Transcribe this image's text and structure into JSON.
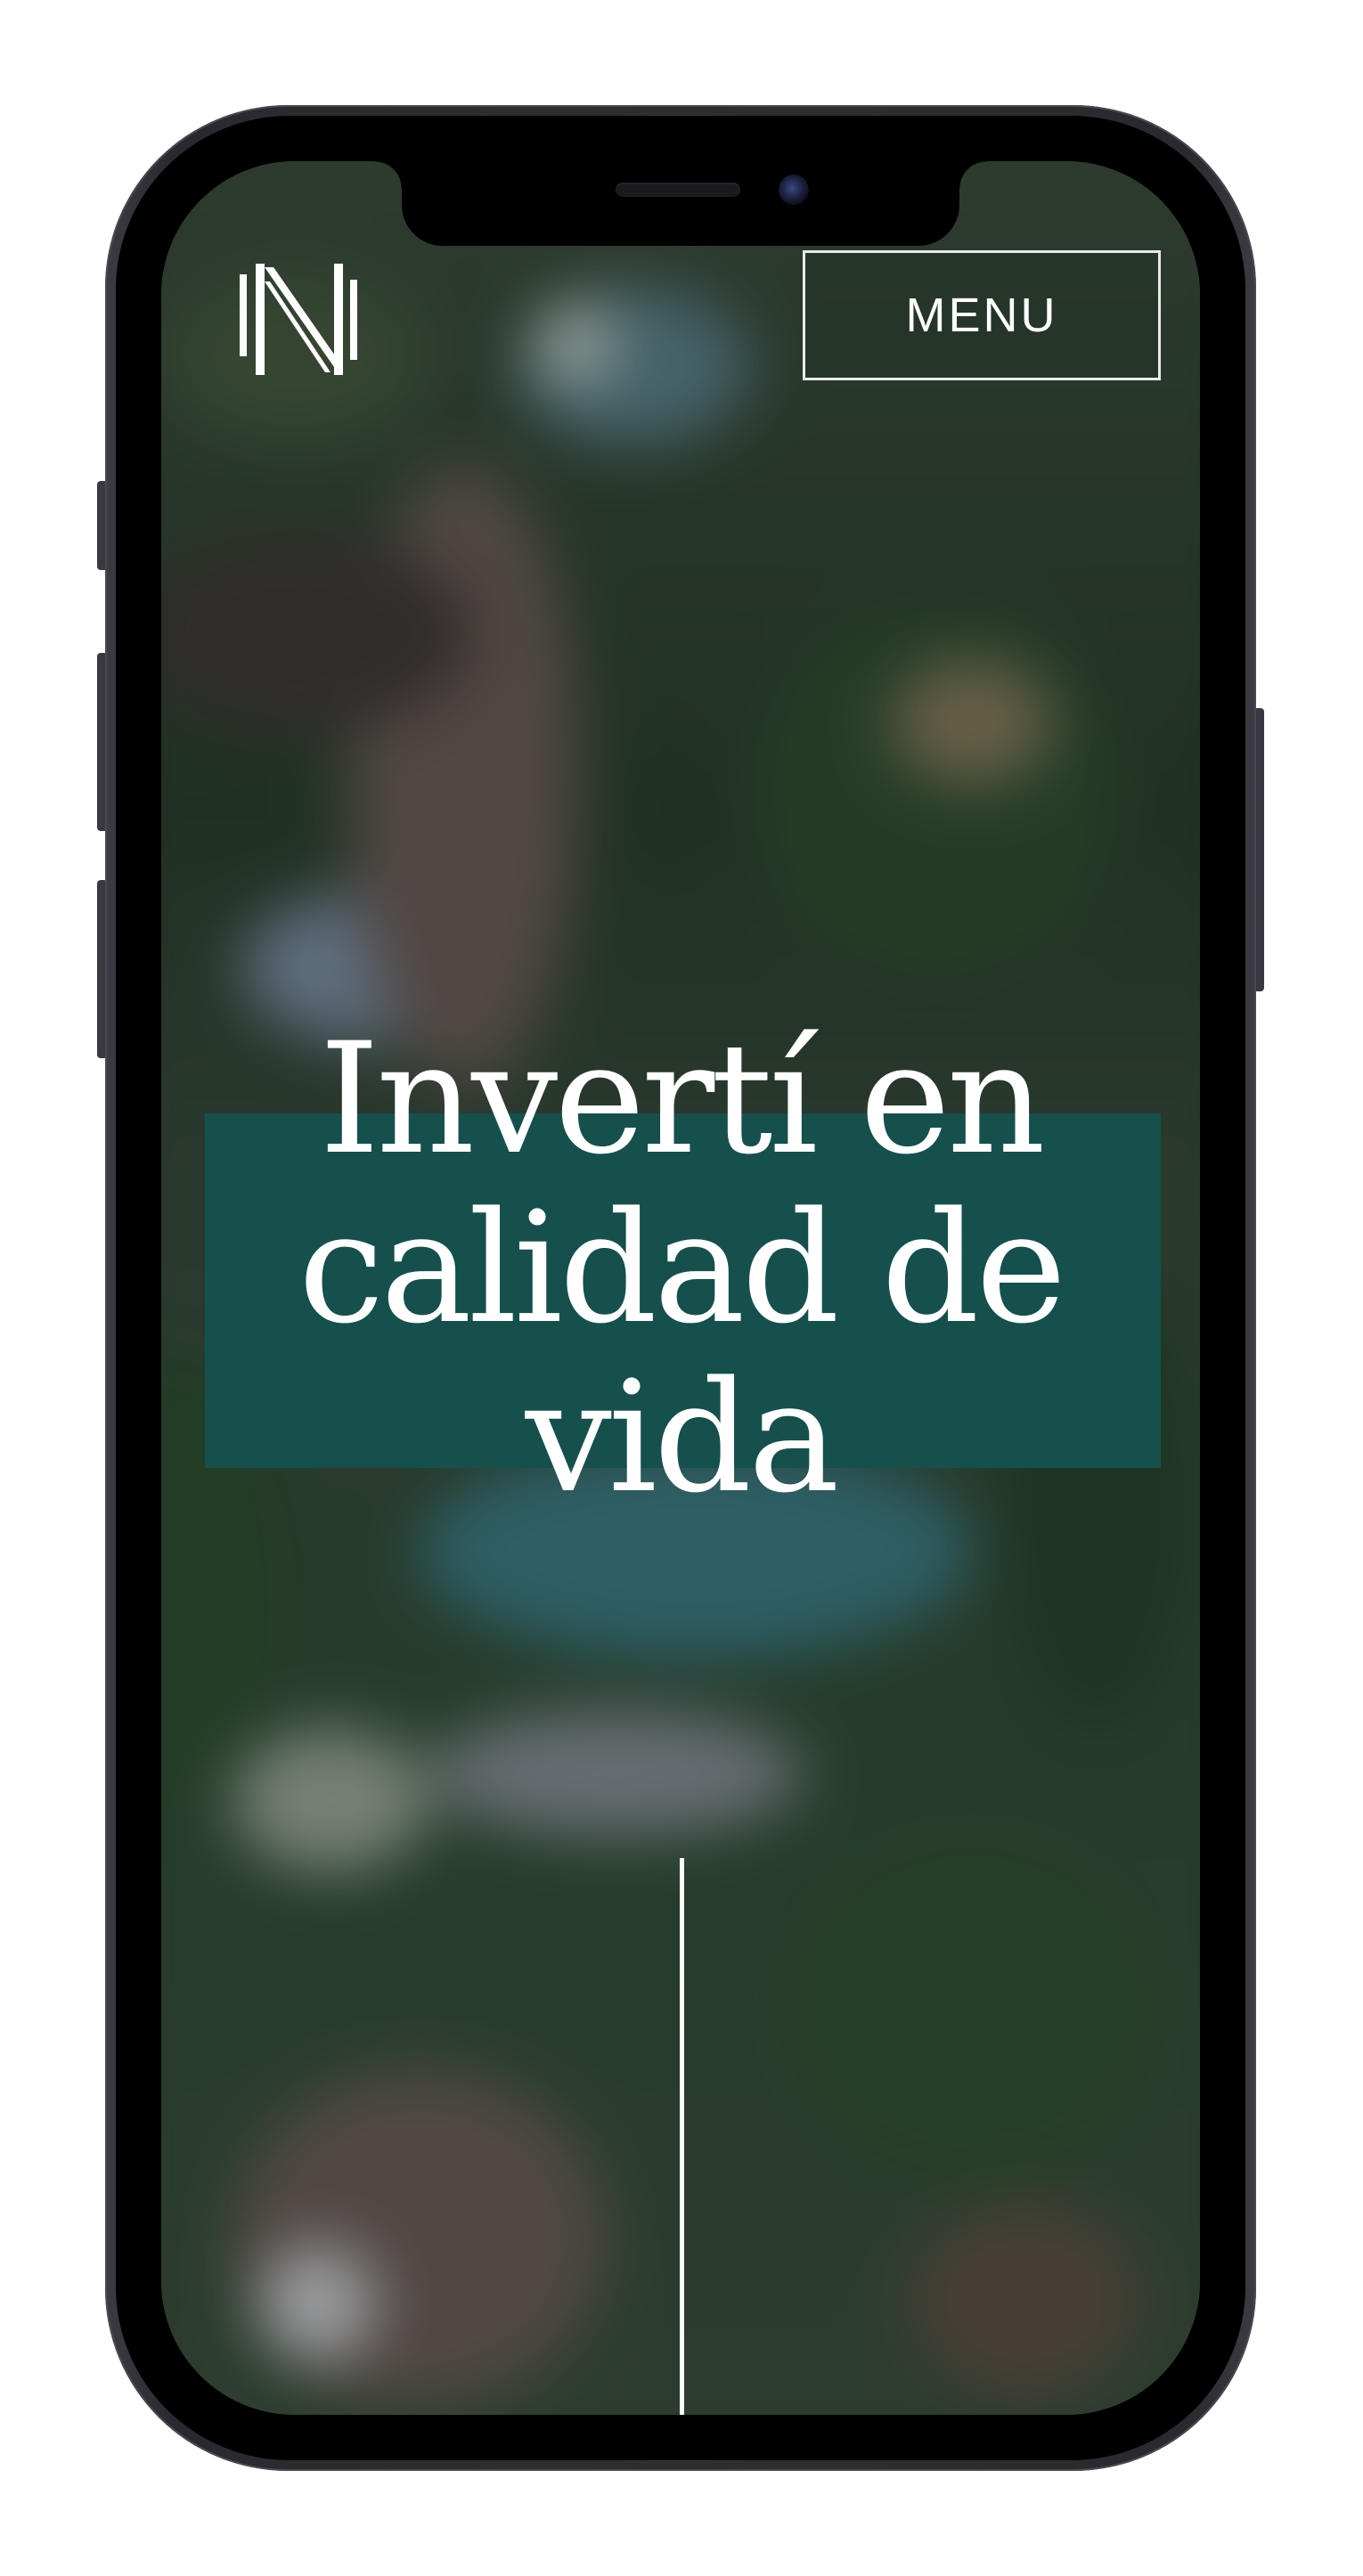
{
  "header": {
    "logo_icon": "brand-monogram-icon",
    "menu_label": "MENU"
  },
  "hero": {
    "title": "Invertí en calidad de vida",
    "band_color": "#15504d"
  },
  "colors": {
    "accent": "#15504d",
    "text": "#ffffff",
    "frame": "#2e2d33"
  }
}
